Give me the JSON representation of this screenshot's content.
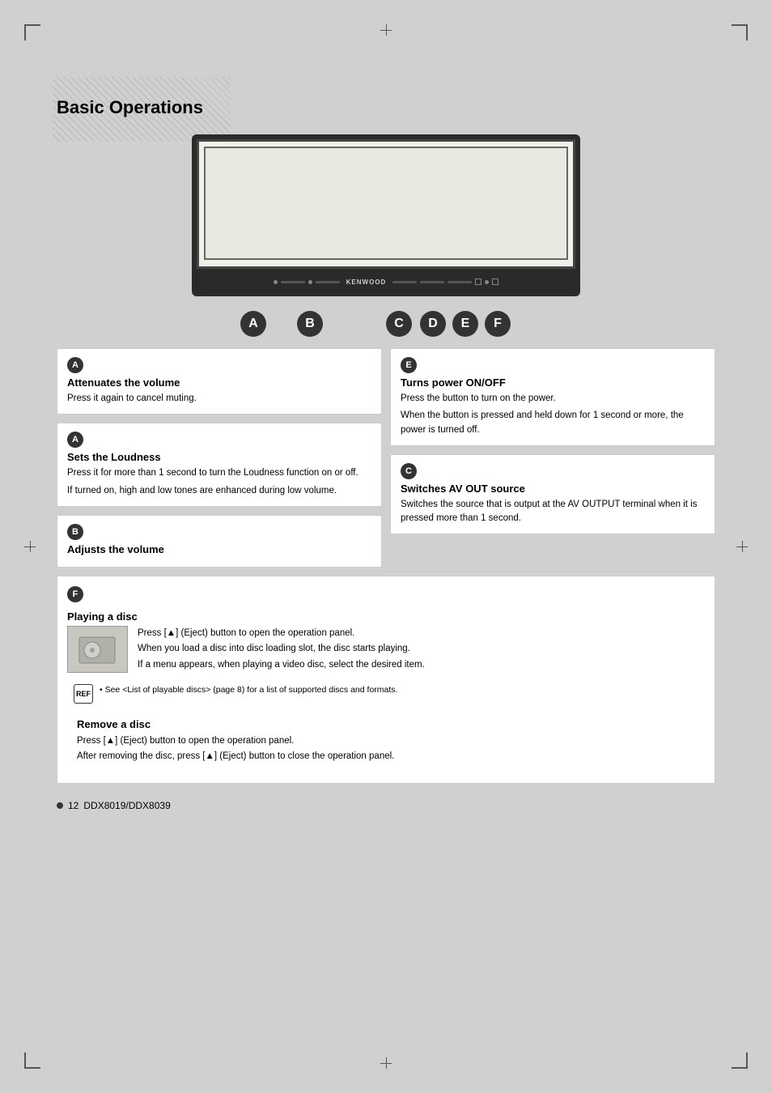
{
  "page": {
    "title": "Basic Operations",
    "page_number": "12",
    "page_label": "DDX8019/DDX8039"
  },
  "labels": {
    "a1": "A",
    "a2": "A",
    "b": "B",
    "c": "C",
    "d": "D",
    "e": "E",
    "f": "F"
  },
  "sections": {
    "attenuates": {
      "badge": "A",
      "title": "Attenuates the volume",
      "text": "Press it again to cancel muting."
    },
    "loudness": {
      "badge": "A",
      "title": "Sets the Loudness",
      "text1": "Press it for more than 1 second to turn the Loudness function on or off.",
      "text2": "If turned on, high and low tones are enhanced during low volume."
    },
    "volume": {
      "badge": "B",
      "title": "Adjusts the volume"
    },
    "turns_power": {
      "badge": "E",
      "title": "Turns power ON/OFF",
      "text1": "Press the button to turn on the power.",
      "text2": "When the button is pressed and held down for 1 second or more, the power is turned off."
    },
    "av_out": {
      "badge": "C",
      "title": "Switches AV OUT source",
      "text": "Switches the source that is output at the AV OUTPUT terminal when it is pressed more than 1 second."
    },
    "playing_disc": {
      "badge": "F",
      "title": "Playing a disc",
      "line1": "Press [▲] (Eject) button to open the operation panel.",
      "line2": "When you load a disc into disc loading slot, the disc starts playing.",
      "line3": "If a menu appears, when playing a video disc, select the desired item."
    },
    "note": {
      "icon_text": "REF",
      "text": "• See <List of playable discs> (page 8) for a list of supported discs and formats."
    },
    "remove_disc": {
      "title": "Remove a disc",
      "line1": "Press [▲] (Eject) button to open the operation panel.",
      "line2": "After removing the disc, press [▲] (Eject) button to close the operation panel."
    }
  }
}
